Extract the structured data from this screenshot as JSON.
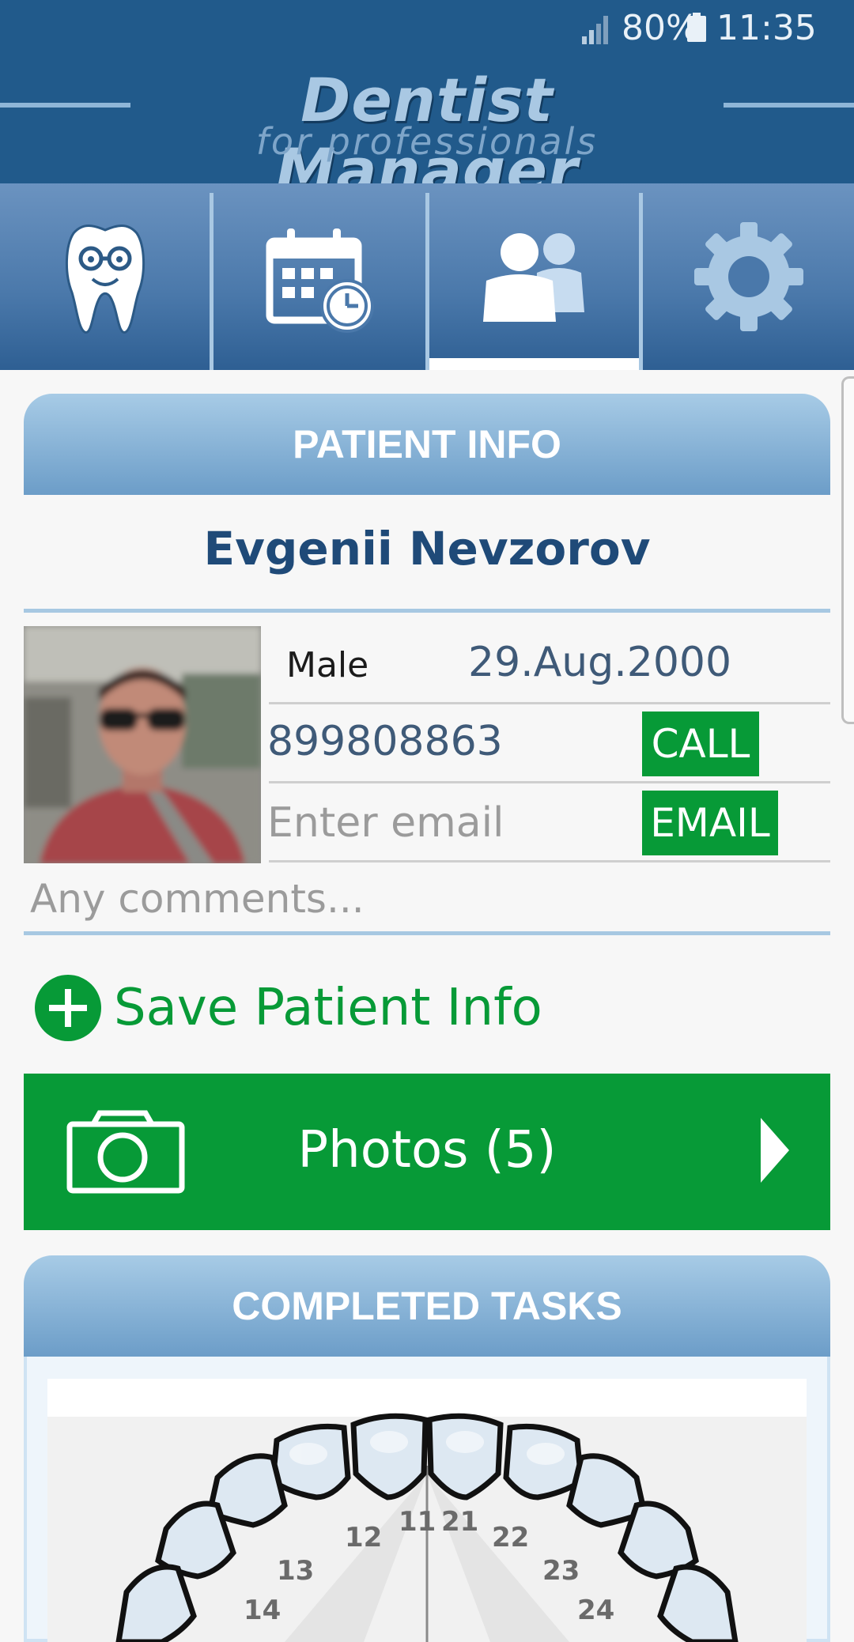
{
  "status_bar": {
    "battery": "80%",
    "time": "11:35"
  },
  "app": {
    "title": "Dentist Manager",
    "subtitle": "for professionals"
  },
  "nav": {
    "tabs": [
      {
        "name": "patients-tooth",
        "icon": "tooth-icon"
      },
      {
        "name": "calendar",
        "icon": "calendar-clock-icon"
      },
      {
        "name": "people",
        "icon": "people-icon",
        "active": true
      },
      {
        "name": "settings",
        "icon": "gear-icon"
      }
    ]
  },
  "patient_info": {
    "header": "PATIENT INFO",
    "name": "Evgenii Nevzorov",
    "gender": "Male",
    "dob": "29.Aug.2000",
    "phone": "899808863",
    "call_label": "CALL",
    "email_placeholder": "Enter email",
    "email_label": "EMAIL",
    "comments_placeholder": "Any comments..."
  },
  "save_label": "Save Patient Info",
  "photos": {
    "label": "Photos",
    "count": "(5)"
  },
  "completed_tasks": {
    "header": "COMPLETED TASKS",
    "tooth_numbers": [
      "11",
      "12",
      "13",
      "14",
      "21",
      "22",
      "23",
      "24"
    ]
  },
  "colors": {
    "header_blue": "#215a8b",
    "accent_green": "#079a37",
    "light_blue": "#a7cbe6"
  }
}
